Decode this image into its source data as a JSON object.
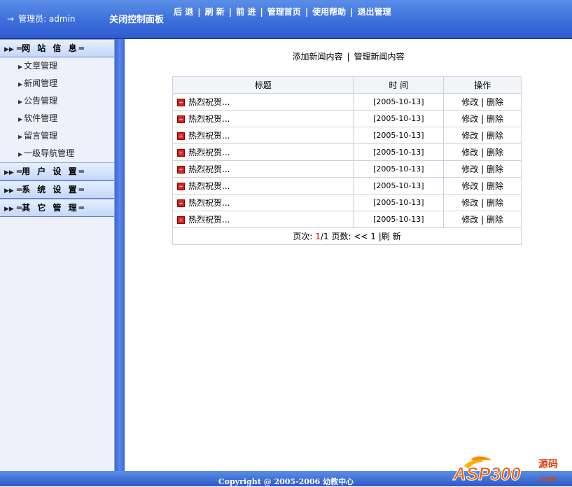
{
  "topbar": {
    "admin_arrow": "→",
    "admin_label": "管理员: admin",
    "close_panel": "关闭控制面板",
    "nav": [
      "后 退",
      "刷 新",
      "前 进",
      "管理首页",
      "使用帮助",
      "退出管理"
    ],
    "nav_sep": "|"
  },
  "sidebar": {
    "sections": [
      {
        "label": "网 站 信 息",
        "items": [
          "文章管理",
          "新闻管理",
          "公告管理",
          "软件管理",
          "留言管理",
          "一级导航管理"
        ]
      },
      {
        "label": "用 户 设 置"
      },
      {
        "label": "系 统 设 置"
      },
      {
        "label": "其 它 管 理"
      }
    ],
    "dash": "═"
  },
  "main": {
    "actions": [
      "添加新闻内容",
      "管理新闻内容"
    ],
    "actions_sep": "|",
    "table": {
      "headers": [
        "标题",
        "时 间",
        "操作"
      ],
      "rows": [
        {
          "title": "热烈祝贺...",
          "time": "[2005-10-13]",
          "edit": "修改",
          "delete": "删除"
        },
        {
          "title": "热烈祝贺...",
          "time": "[2005-10-13]",
          "edit": "修改",
          "delete": "删除"
        },
        {
          "title": "热烈祝贺...",
          "time": "[2005-10-13]",
          "edit": "修改",
          "delete": "删除"
        },
        {
          "title": "热烈祝贺...",
          "time": "[2005-10-13]",
          "edit": "修改",
          "delete": "删除"
        },
        {
          "title": "热烈祝贺...",
          "time": "[2005-10-13]",
          "edit": "修改",
          "delete": "删除"
        },
        {
          "title": "热烈祝贺...",
          "time": "[2005-10-13]",
          "edit": "修改",
          "delete": "删除"
        },
        {
          "title": "热烈祝贺...",
          "time": "[2005-10-13]",
          "edit": "修改",
          "delete": "删除"
        },
        {
          "title": "热烈祝贺...",
          "time": "[2005-10-13]",
          "edit": "修改",
          "delete": "删除"
        }
      ],
      "ops_sep": "|"
    },
    "pager": {
      "label_page": "页次:",
      "current": "1",
      "total": "/1",
      "label_pages": "页数:",
      "prev": "<<",
      "page_link": "1",
      "refresh": "|刷 新"
    }
  },
  "footer": {
    "copyright": "Copyright @ 2005-2006 幼教中心"
  },
  "watermark": {
    "brand": "ASP300",
    "suffix": ".com",
    "tag": "源码"
  },
  "colors": {
    "topbar": "#3d6fdc",
    "divider": "#4a76de",
    "sidebar_bg": "#eef0fa",
    "row_icon": "#d42020",
    "pager_current": "#c00000"
  }
}
